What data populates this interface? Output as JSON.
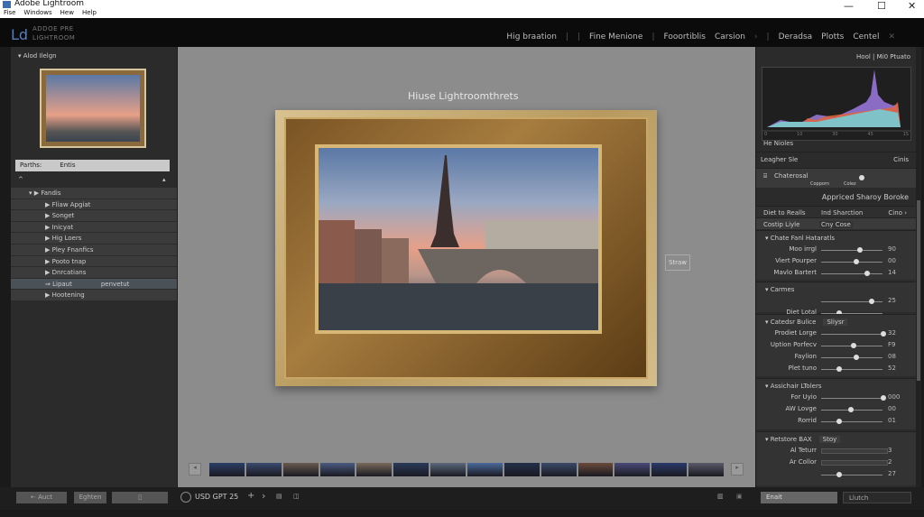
{
  "window": {
    "title": "Adobe Lightroom",
    "menu": [
      "Fise",
      "Windows",
      "Hew",
      "Help"
    ],
    "controls": [
      "—",
      "☐",
      "✕"
    ]
  },
  "header": {
    "logo": "Ld",
    "app_name_1": "ADDOE PRE",
    "app_name_2": "LIGHTROOM",
    "modules": [
      "Hig braation",
      "|",
      "|",
      "Fine Menione",
      "|",
      "Fooortiblis",
      "Carsion",
      "›",
      "|",
      "Deradsa",
      "Plotts",
      "Centel"
    ],
    "close": "✕"
  },
  "left": {
    "panel_title": "Alod Ilelgn",
    "path_label": "Parths:",
    "path_value": "Entis",
    "tree_root": "Fandis",
    "items": [
      {
        "label": "Fliaw Apgiat"
      },
      {
        "label": "Songet"
      },
      {
        "label": "Inicyat"
      },
      {
        "label": "Hig Loers"
      },
      {
        "label": "Pley Fnanfics"
      },
      {
        "label": "Pooto tnap"
      },
      {
        "label": "Dnrcatians"
      },
      {
        "label": "Lipaut",
        "extra": "penvetut",
        "selected": true
      },
      {
        "label": "Hootening"
      }
    ],
    "buttons": {
      "back": "Auct",
      "second": "Eghten",
      "third": "▯"
    }
  },
  "center": {
    "image_title": "Hiuse Lightroomthrets",
    "show_button": "Straw",
    "filmstrip_left": "◂",
    "filmstrip_right": "▸"
  },
  "bottom": {
    "zoom_label": "USD GPT 25",
    "plus": "+",
    "next": "›",
    "right_btns": [
      "Enait",
      "Llutch"
    ]
  },
  "right": {
    "histogram_title": "Hool | Mi0 Ptuato",
    "histogram_ticks": [
      "0",
      "10",
      "30",
      "45",
      "1S"
    ],
    "histogram_info": "He Nioles",
    "preset_header": "Leagher Sle",
    "preset_header_right": "Cinis",
    "preset_name": "Chaterosal",
    "preset_sub_1": "Copporn",
    "preset_sub_2": "Colez",
    "basic_title": "Appriced Sharoy Boroke",
    "tabs": [
      "Diet to Realls",
      "Ind Sharction",
      "Cino ›"
    ],
    "tabs2": [
      "Costip Liyle",
      "Cny Cose"
    ],
    "sections": [
      {
        "title": "Chate Fanl Hataratls",
        "rows": [
          {
            "label": "Moo irrgl",
            "value": "90",
            "pos": 0.6
          },
          {
            "label": "Viert Pourper",
            "value": "00",
            "pos": 0.55
          },
          {
            "label": "Mavlo Bartert",
            "value": "14",
            "pos": 0.72
          }
        ]
      },
      {
        "title": "Carmes",
        "rows": [
          {
            "label": "",
            "value": "25",
            "pos": 0.8
          },
          {
            "label": "Diet Lotal",
            "value": "",
            "pos": 0.25
          }
        ]
      },
      {
        "title": "Catedsr Bulice",
        "tag": "Sliysr",
        "rows": [
          {
            "label": "Prodiet Lorge",
            "value": "32",
            "pos": 1.0
          },
          {
            "label": "Uption Porfecv",
            "value": "F9",
            "pos": 0.5
          },
          {
            "label": "Faylion",
            "value": "08",
            "pos": 0.55
          },
          {
            "label": "Plet tuno",
            "value": "52",
            "pos": 0.25
          }
        ]
      },
      {
        "title": "Assichair LTolers",
        "rows": [
          {
            "label": "For Uyio",
            "value": "000",
            "pos": 1.0
          },
          {
            "label": "AW Lovge",
            "value": "00",
            "pos": 0.45
          },
          {
            "label": "Rorrid",
            "value": "01",
            "pos": 0.25
          }
        ]
      },
      {
        "title": "Retstore BAX",
        "tag": "Stoy",
        "rows": [
          {
            "label": "Al Teturr",
            "value": "3",
            "pos": null
          },
          {
            "label": "Ar Collor",
            "value": "2",
            "pos": null
          },
          {
            "label": "",
            "value": "27",
            "pos": 0.25
          }
        ]
      }
    ]
  },
  "colors": {
    "accent": "#5a7fb5",
    "panel": "#2b2b2b",
    "center": "#8c8c8c"
  }
}
